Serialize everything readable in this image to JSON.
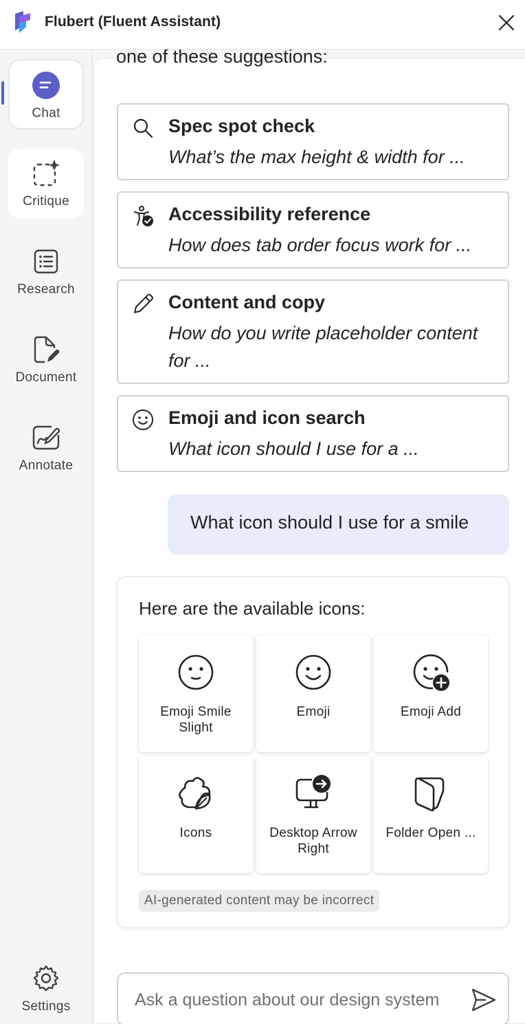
{
  "app": {
    "title": "Flubert (Fluent Assistant)",
    "accent_color": "#5b5fc7",
    "logo_colors": [
      "#5b5fc7",
      "#8a63e6",
      "#3ea0f5"
    ]
  },
  "sidebar": {
    "items": [
      {
        "label": "Chat",
        "icon": "chat-bubble-icon",
        "active": true
      },
      {
        "label": "Critique",
        "icon": "sparkle-selection-icon",
        "active": false
      },
      {
        "label": "Research",
        "icon": "list-document-icon",
        "active": false
      },
      {
        "label": "Document",
        "icon": "document-edit-icon",
        "active": false
      },
      {
        "label": "Annotate",
        "icon": "annotate-pen-icon",
        "active": false
      }
    ],
    "settings_label": "Settings"
  },
  "chat": {
    "intro_partial": "one of these suggestions:",
    "suggestions": [
      {
        "title": "Spec spot check",
        "subtitle": "What’s the max height & width for ...",
        "icon": "search-icon"
      },
      {
        "title": "Accessibility reference",
        "subtitle": "How does tab order focus work for ...",
        "icon": "accessibility-check-icon"
      },
      {
        "title": "Content and copy",
        "subtitle": "How do you write placeholder content for ...",
        "icon": "pencil-icon"
      },
      {
        "title": "Emoji and icon search",
        "subtitle": "What icon should I use for a ...",
        "icon": "emoji-icon"
      }
    ],
    "user_message": "What icon should I use for a smile",
    "answer": {
      "intro": "Here are the available icons:",
      "icons": [
        {
          "label": "Emoji Smile Slight",
          "icon": "emoji-smile-slight-icon"
        },
        {
          "label": "Emoji",
          "icon": "emoji-icon"
        },
        {
          "label": "Emoji Add",
          "icon": "emoji-add-icon"
        },
        {
          "label": "Icons",
          "icon": "icons-icon"
        },
        {
          "label": "Desktop Arrow Right",
          "icon": "desktop-arrow-right-icon"
        },
        {
          "label": "Folder Open ...",
          "icon": "folder-open-icon"
        }
      ],
      "disclaimer": "AI-generated content may be incorrect"
    }
  },
  "composer": {
    "placeholder": "Ask a question about our design system",
    "value": ""
  }
}
